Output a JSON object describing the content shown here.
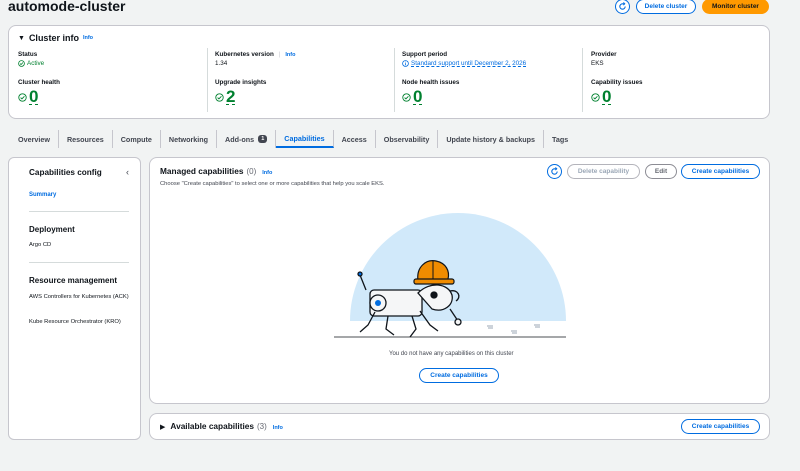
{
  "page": {
    "title": "automode-cluster",
    "delete_label": "Delete cluster",
    "monitor_label": "Monitor cluster"
  },
  "cluster_info": {
    "heading": "Cluster info",
    "info": "Info",
    "status_label": "Status",
    "status_value": "Active",
    "k8s_label": "Kubernetes version",
    "k8s_info": "Info",
    "k8s_value": "1.34",
    "support_label": "Support period",
    "support_value": "Standard support until December 2, 2026",
    "provider_label": "Provider",
    "provider_value": "EKS",
    "health_label": "Cluster health",
    "health_value": "0",
    "upgrade_label": "Upgrade insights",
    "upgrade_value": "2",
    "node_label": "Node health issues",
    "node_value": "0",
    "capability_label": "Capability issues",
    "capability_value": "0"
  },
  "tabs": [
    {
      "label": "Overview"
    },
    {
      "label": "Resources"
    },
    {
      "label": "Compute"
    },
    {
      "label": "Networking"
    },
    {
      "label": "Add-ons",
      "badge": "1"
    },
    {
      "label": "Capabilities"
    },
    {
      "label": "Access"
    },
    {
      "label": "Observability"
    },
    {
      "label": "Update history & backups"
    },
    {
      "label": "Tags"
    }
  ],
  "sidebar": {
    "title": "Capabilities config",
    "summary": "Summary",
    "deployment_heading": "Deployment",
    "argo": "Argo CD",
    "resource_heading": "Resource management",
    "ack": "AWS Controllers for Kubernetes (ACK)",
    "kro": "Kube Resource Orchestrator (KRO)"
  },
  "managed": {
    "title": "Managed capabilities",
    "count": "(0)",
    "info": "Info",
    "description": "Choose \"Create capabilities\" to select one or more capabilities that help you scale EKS.",
    "delete_label": "Delete capability",
    "edit_label": "Edit",
    "create_label": "Create capabilities",
    "empty_text": "You do not have any capabilities on this cluster",
    "empty_create_label": "Create capabilities"
  },
  "available": {
    "title": "Available capabilities",
    "count": "(3)",
    "info": "Info",
    "create_label": "Create capabilities"
  },
  "colors": {
    "accent": "#006ce0",
    "primary_button": "#ff9900",
    "success": "#00802f"
  }
}
